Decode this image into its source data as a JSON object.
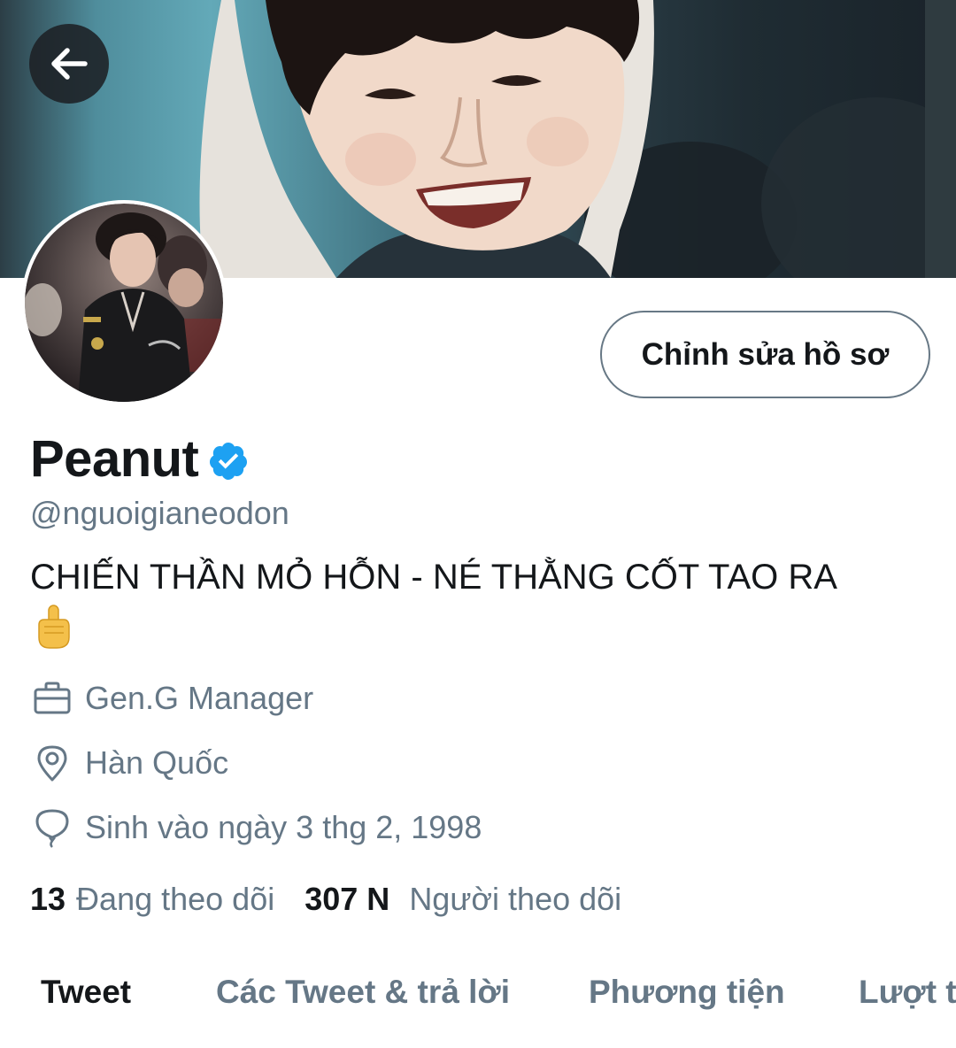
{
  "header": {
    "back_icon": "arrow-left-icon",
    "banner_alt": "Ảnh bìa"
  },
  "profile": {
    "avatar_alt": "Ảnh đại diện",
    "edit_button_label": "Chỉnh sửa hồ sơ",
    "display_name": "Peanut",
    "verified_icon": "verified-badge-icon",
    "handle": "@nguoigianeodon",
    "bio_text": "CHIẾN THẦN MỎ HỖN - NÉ THẰNG CỐT TAO RA",
    "bio_emoji_icon": "pointing-finger-emoji-icon"
  },
  "meta": {
    "work": {
      "icon": "briefcase-icon",
      "text": "Gen.G Manager"
    },
    "location": {
      "icon": "location-pin-icon",
      "text": "Hàn Quốc"
    },
    "birthday": {
      "icon": "balloon-icon",
      "text": "Sinh vào ngày 3 thg 2, 1998"
    }
  },
  "stats": {
    "following_count": "13",
    "following_label": "Đang theo dõi",
    "followers_count": "307 N",
    "followers_label": "Người theo dõi"
  },
  "tabs": [
    {
      "label": "Tweet",
      "active": true
    },
    {
      "label": "Các Tweet & trả lời",
      "active": false
    },
    {
      "label": "Phương tiện",
      "active": false
    },
    {
      "label": "Lượt thích",
      "active": false
    }
  ],
  "colors": {
    "primary_text": "#14171a",
    "secondary_text": "#657786",
    "verified_blue": "#1da1f2",
    "button_border": "#677885"
  }
}
